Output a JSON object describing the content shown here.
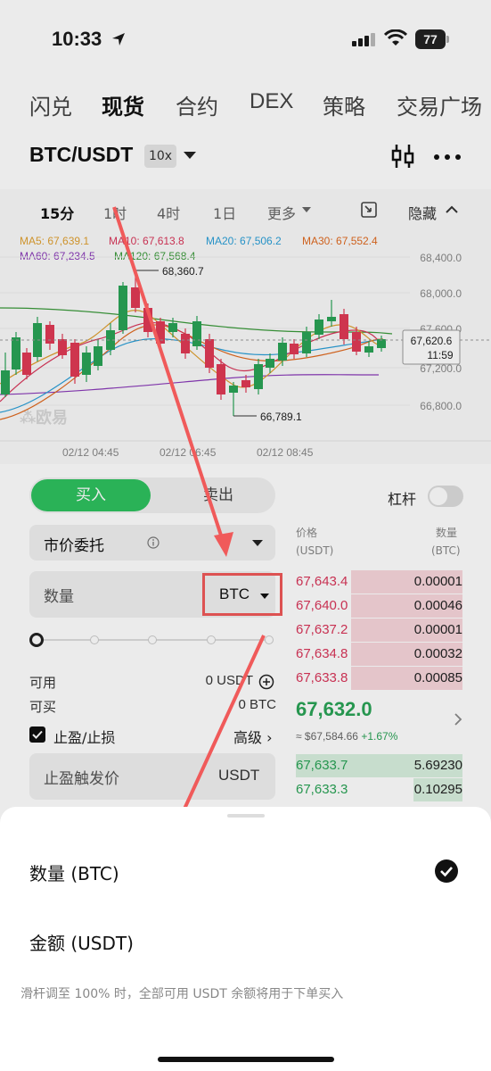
{
  "status_bar": {
    "time": "10:33",
    "battery": "77"
  },
  "top_nav": {
    "items": [
      "闪兑",
      "现货",
      "合约",
      "DEX",
      "策略",
      "交易广场"
    ],
    "active": "现货"
  },
  "pair": {
    "symbol": "BTC/USDT",
    "leverage": "10x"
  },
  "chart": {
    "intervals": [
      "15分",
      "1时",
      "4时",
      "1日",
      "更多"
    ],
    "active_interval": "15分",
    "hide_label": "隐藏",
    "ma": {
      "ma5": "MA5: 67,639.1",
      "ma10": "MA10: 67,613.8",
      "ma20": "MA20: 67,506.2",
      "ma30": "MA30: 67,552.4",
      "ma60": "MA60: 67,234.5",
      "ma120": "MA120: 67,568.4"
    },
    "y_ticks": [
      "68,400.0",
      "68,000.0",
      "67,600.0",
      "67,200.0",
      "66,800.0"
    ],
    "x_ticks": [
      "02/12 04:45",
      "02/12 06:45",
      "02/12 08:45"
    ],
    "high_label": "68,360.7",
    "low_label": "66,789.1",
    "current_price": "67,620.6",
    "countdown": "11:59",
    "watermark": "欧易",
    "colors": {
      "up": "#2aa356",
      "down": "#e03a55"
    }
  },
  "order_form": {
    "buy_label": "买入",
    "sell_label": "卖出",
    "leverage_label": "杠杆",
    "order_type": "市价委托",
    "quantity_placeholder": "数量",
    "unit": "BTC",
    "available_label": "可用",
    "available_value": "0 USDT",
    "can_buy_label": "可买",
    "can_buy_value": "0 BTC",
    "tp_sl_label": "止盈/止损",
    "advanced_label": "高级 ›",
    "tp_trigger_placeholder": "止盈触发价",
    "tp_unit": "USDT"
  },
  "order_book": {
    "price_header": "价格",
    "price_unit": "(USDT)",
    "qty_header": "数量",
    "qty_unit": "(BTC)",
    "asks": [
      {
        "price": "67,643.4",
        "qty": "0.00001"
      },
      {
        "price": "67,640.0",
        "qty": "0.00046"
      },
      {
        "price": "67,637.2",
        "qty": "0.00001"
      },
      {
        "price": "67,634.8",
        "qty": "0.00032"
      },
      {
        "price": "67,633.8",
        "qty": "0.00085"
      }
    ],
    "last_price": "67,632.0",
    "approx_value": "≈ $67,584.66",
    "change": "+1.67%",
    "bids": [
      {
        "price": "67,633.7",
        "qty": "5.69230"
      },
      {
        "price": "67,633.3",
        "qty": "0.10295"
      }
    ]
  },
  "sheet": {
    "option_qty": "数量 (BTC)",
    "option_amount": "金额 (USDT)",
    "hint": "滑杆调至 100% 时，全部可用 USDT 余额将用于下单买入"
  }
}
